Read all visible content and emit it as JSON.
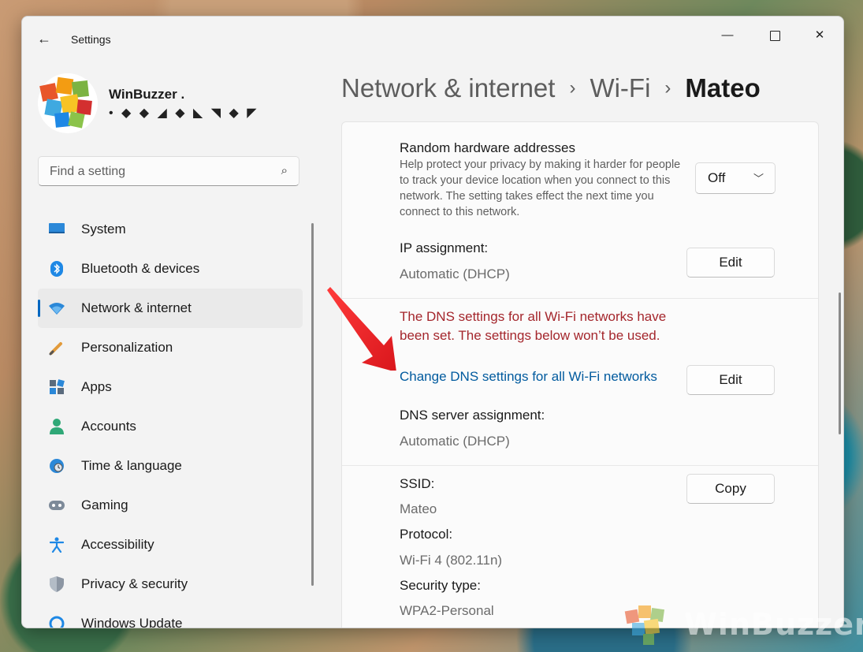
{
  "window": {
    "title": "Settings",
    "controls": {
      "minimize": "—",
      "close": "✕"
    }
  },
  "user": {
    "name": "WinBuzzer .",
    "email_masked": "• ◆ ◆ ◢ ◆ ◣ ◥ ◆ ◤"
  },
  "search": {
    "placeholder": "Find a setting"
  },
  "nav": {
    "items": [
      {
        "label": "System",
        "icon": "monitor-icon",
        "active": false
      },
      {
        "label": "Bluetooth & devices",
        "icon": "bluetooth-icon",
        "active": false
      },
      {
        "label": "Network & internet",
        "icon": "wifi-icon",
        "active": true
      },
      {
        "label": "Personalization",
        "icon": "brush-icon",
        "active": false
      },
      {
        "label": "Apps",
        "icon": "apps-icon",
        "active": false
      },
      {
        "label": "Accounts",
        "icon": "person-icon",
        "active": false
      },
      {
        "label": "Time & language",
        "icon": "globe-clock-icon",
        "active": false
      },
      {
        "label": "Gaming",
        "icon": "gamepad-icon",
        "active": false
      },
      {
        "label": "Accessibility",
        "icon": "accessibility-icon",
        "active": false
      },
      {
        "label": "Privacy & security",
        "icon": "shield-icon",
        "active": false
      },
      {
        "label": "Windows Update",
        "icon": "update-icon",
        "active": false
      }
    ]
  },
  "breadcrumb": {
    "part1": "Network & internet",
    "part2": "Wi-Fi",
    "current": "Mateo",
    "separator": "›"
  },
  "settings": {
    "random_hw": {
      "label": "Random hardware addresses",
      "description": "Help protect your privacy by making it harder for people to track your device location when you connect to this network. The setting takes effect the next time you connect to this network.",
      "value": "Off"
    },
    "ip": {
      "label": "IP assignment:",
      "value": "Automatic (DHCP)",
      "button": "Edit"
    },
    "dns": {
      "warning": "The DNS settings for all Wi-Fi networks have been set. The settings below won’t be used.",
      "link": "Change DNS settings for all Wi-Fi networks",
      "button": "Edit",
      "label": "DNS server assignment:",
      "value": "Automatic (DHCP)"
    },
    "ssid": {
      "label": "SSID:",
      "value": "Mateo",
      "button": "Copy"
    },
    "protocol": {
      "label": "Protocol:",
      "value": "Wi-Fi 4 (802.11n)"
    },
    "security": {
      "label": "Security type:",
      "value": "WPA2-Personal"
    }
  },
  "watermark": {
    "text": "WinBuzzer"
  },
  "colors": {
    "accent": "#0067c0",
    "warning": "#a4262c",
    "link": "#005a9e",
    "arrow": "#e8242a"
  }
}
